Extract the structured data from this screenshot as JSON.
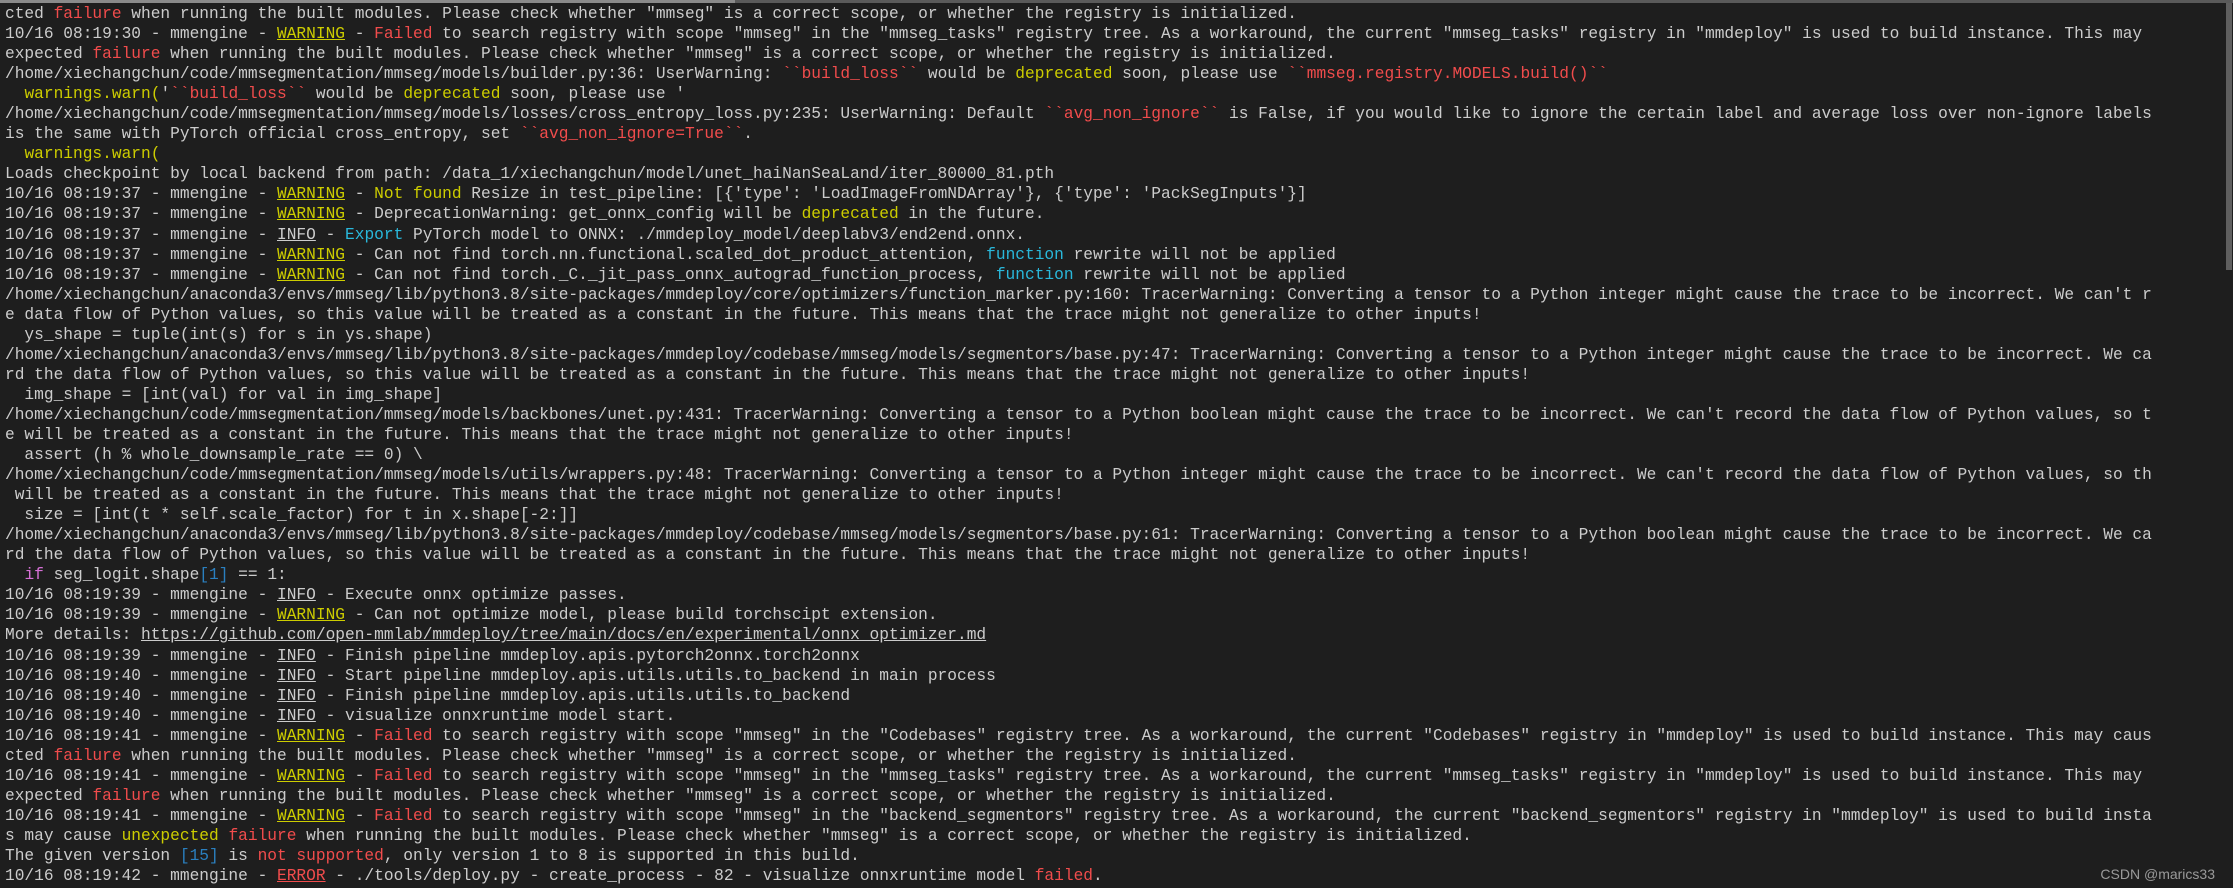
{
  "colors": {
    "background": "#1e1e1e",
    "text": "#cccccc",
    "red": "#f14c4c",
    "yellow": "#cdcd00",
    "cyan": "#29b8db",
    "magenta": "#d670d6",
    "blue": "#2a7fbf"
  },
  "watermark": "CSDN @marics33",
  "lines": [
    [
      [
        "cted ",
        ""
      ],
      [
        "failure",
        "r"
      ],
      [
        " when running the built modules. Please check whether \"mmseg\" is a correct scope, or whether the registry is initialized.",
        ""
      ]
    ],
    [
      [
        "10/16 08:19:30 - mmengine - ",
        ""
      ],
      [
        "WARNING",
        "wu"
      ],
      [
        " - ",
        ""
      ],
      [
        "Failed",
        "r"
      ],
      [
        " to search registry with scope \"mmseg\" in the \"mmseg_tasks\" registry tree. As a workaround, the current \"mmseg_tasks\" registry in \"mmdeploy\" is used to build instance. This may",
        ""
      ]
    ],
    [
      [
        "expected ",
        ""
      ],
      [
        "failure",
        "r"
      ],
      [
        " when running the built modules. Please check whether \"mmseg\" is a correct scope, or whether the registry is initialized.",
        ""
      ]
    ],
    [
      [
        "/home/xiechangchun/code/mmsegmentation/mmseg/models/builder.py:36: UserWarning: ",
        ""
      ],
      [
        "``build_loss``",
        "r"
      ],
      [
        " would be ",
        ""
      ],
      [
        "deprecated",
        "y"
      ],
      [
        " soon, please use ",
        ""
      ],
      [
        "``mmseg.registry.MODELS.build()``",
        "r"
      ]
    ],
    [
      [
        "  ",
        ""
      ],
      [
        "warnings.warn(",
        "y"
      ],
      [
        "'",
        ""
      ],
      [
        "``build_loss``",
        "r"
      ],
      [
        " would be ",
        ""
      ],
      [
        "deprecated",
        "y"
      ],
      [
        " soon, please use '",
        ""
      ]
    ],
    [
      [
        "/home/xiechangchun/code/mmsegmentation/mmseg/models/losses/cross_entropy_loss.py:235: UserWarning: Default ",
        ""
      ],
      [
        "``avg_non_ignore``",
        "r"
      ],
      [
        " is False, if you would like to ignore the certain label and average loss over non-ignore labels",
        ""
      ]
    ],
    [
      [
        "is the same with PyTorch official cross_entropy, set ",
        ""
      ],
      [
        "``avg_non_ignore=True``",
        "r"
      ],
      [
        ".",
        ""
      ]
    ],
    [
      [
        "  ",
        ""
      ],
      [
        "warnings.warn(",
        "y"
      ]
    ],
    [
      [
        "Loads checkpoint by local backend from path: /data_1/xiechangchun/model/unet_haiNanSeaLand/iter_80000_81.pth",
        ""
      ]
    ],
    [
      [
        "10/16 08:19:37 - mmengine - ",
        ""
      ],
      [
        "WARNING",
        "wu"
      ],
      [
        " - ",
        ""
      ],
      [
        "Not found",
        "y"
      ],
      [
        " Resize in test_pipeline: [{'type': 'LoadImageFromNDArray'}, {'type': 'PackSegInputs'}]",
        ""
      ]
    ],
    [
      [
        "10/16 08:19:37 - mmengine - ",
        ""
      ],
      [
        "WARNING",
        "wu"
      ],
      [
        " - DeprecationWarning: get_onnx_config will be ",
        ""
      ],
      [
        "deprecated",
        "y"
      ],
      [
        " in the future.",
        ""
      ]
    ],
    [
      [
        "10/16 08:19:37 - mmengine - ",
        ""
      ],
      [
        "INFO",
        "iu"
      ],
      [
        " - ",
        ""
      ],
      [
        "Export",
        "c"
      ],
      [
        " PyTorch model to ONNX: ./mmdeploy_model/deeplabv3/end2end.onnx.",
        ""
      ]
    ],
    [
      [
        "10/16 08:19:37 - mmengine - ",
        ""
      ],
      [
        "WARNING",
        "wu"
      ],
      [
        " - Can not find torch.nn.functional.scaled_dot_product_attention, ",
        ""
      ],
      [
        "function",
        "c"
      ],
      [
        " rewrite will not be applied",
        ""
      ]
    ],
    [
      [
        "10/16 08:19:37 - mmengine - ",
        ""
      ],
      [
        "WARNING",
        "wu"
      ],
      [
        " - Can not find torch._C._jit_pass_onnx_autograd_function_process, ",
        ""
      ],
      [
        "function",
        "c"
      ],
      [
        " rewrite will not be applied",
        ""
      ]
    ],
    [
      [
        "/home/xiechangchun/anaconda3/envs/mmseg/lib/python3.8/site-packages/mmdeploy/core/optimizers/function_marker.py:160: TracerWarning: Converting a tensor to a Python integer might cause the trace to be incorrect. We can't r",
        ""
      ]
    ],
    [
      [
        "e data flow of Python values, so this value will be treated as a constant in the future. This means that the trace might not generalize to other inputs!",
        ""
      ]
    ],
    [
      [
        "  ys_shape = tuple(int(s) for s in ys.shape)",
        ""
      ]
    ],
    [
      [
        "/home/xiechangchun/anaconda3/envs/mmseg/lib/python3.8/site-packages/mmdeploy/codebase/mmseg/models/segmentors/base.py:47: TracerWarning: Converting a tensor to a Python integer might cause the trace to be incorrect. We ca",
        ""
      ]
    ],
    [
      [
        "rd the data flow of Python values, so this value will be treated as a constant in the future. This means that the trace might not generalize to other inputs!",
        ""
      ]
    ],
    [
      [
        "  img_shape = [int(val) for val in img_shape]",
        ""
      ]
    ],
    [
      [
        "/home/xiechangchun/code/mmsegmentation/mmseg/models/backbones/unet.py:431: TracerWarning: Converting a tensor to a Python boolean might cause the trace to be incorrect. We can't record the data flow of Python values, so t",
        ""
      ]
    ],
    [
      [
        "e will be treated as a constant in the future. This means that the trace might not generalize to other inputs!",
        ""
      ]
    ],
    [
      [
        "  assert (h % whole_downsample_rate == 0) \\",
        ""
      ]
    ],
    [
      [
        "/home/xiechangchun/code/mmsegmentation/mmseg/models/utils/wrappers.py:48: TracerWarning: Converting a tensor to a Python integer might cause the trace to be incorrect. We can't record the data flow of Python values, so th",
        ""
      ]
    ],
    [
      [
        " will be treated as a constant in the future. This means that the trace might not generalize to other inputs!",
        ""
      ]
    ],
    [
      [
        "  size = [int(t * self.scale_factor) for t in x.shape[-2:]]",
        ""
      ]
    ],
    [
      [
        "/home/xiechangchun/anaconda3/envs/mmseg/lib/python3.8/site-packages/mmdeploy/codebase/mmseg/models/segmentors/base.py:61: TracerWarning: Converting a tensor to a Python boolean might cause the trace to be incorrect. We ca",
        ""
      ]
    ],
    [
      [
        "rd the data flow of Python values, so this value will be treated as a constant in the future. This means that the trace might not generalize to other inputs!",
        ""
      ]
    ],
    [
      [
        "  ",
        ""
      ],
      [
        "if",
        "m"
      ],
      [
        " seg_logit.shape",
        ""
      ],
      [
        "[1]",
        "b"
      ],
      [
        " == 1:",
        ""
      ]
    ],
    [
      [
        "10/16 08:19:39 - mmengine - ",
        ""
      ],
      [
        "INFO",
        "iu"
      ],
      [
        " - Execute onnx optimize passes.",
        ""
      ]
    ],
    [
      [
        "10/16 08:19:39 - mmengine - ",
        ""
      ],
      [
        "WARNING",
        "wu"
      ],
      [
        " - Can not optimize model, please build torchscipt extension.",
        ""
      ]
    ],
    [
      [
        "More details: ",
        ""
      ],
      [
        "https://github.com/open-mmlab/mmdeploy/tree/main/docs/en/experimental/onnx_optimizer.md",
        "u"
      ]
    ],
    [
      [
        "10/16 08:19:39 - mmengine - ",
        ""
      ],
      [
        "INFO",
        "iu"
      ],
      [
        " - Finish pipeline mmdeploy.apis.pytorch2onnx.torch2onnx",
        ""
      ]
    ],
    [
      [
        "10/16 08:19:40 - mmengine - ",
        ""
      ],
      [
        "INFO",
        "iu"
      ],
      [
        " - Start pipeline mmdeploy.apis.utils.utils.to_backend in main process",
        ""
      ]
    ],
    [
      [
        "10/16 08:19:40 - mmengine - ",
        ""
      ],
      [
        "INFO",
        "iu"
      ],
      [
        " - Finish pipeline mmdeploy.apis.utils.utils.to_backend",
        ""
      ]
    ],
    [
      [
        "10/16 08:19:40 - mmengine - ",
        ""
      ],
      [
        "INFO",
        "iu"
      ],
      [
        " - visualize onnxruntime model start.",
        ""
      ]
    ],
    [
      [
        "10/16 08:19:41 - mmengine - ",
        ""
      ],
      [
        "WARNING",
        "wu"
      ],
      [
        " - ",
        ""
      ],
      [
        "Failed",
        "r"
      ],
      [
        " to search registry with scope \"mmseg\" in the \"Codebases\" registry tree. As a workaround, the current \"Codebases\" registry in \"mmdeploy\" is used to build instance. This may caus",
        ""
      ]
    ],
    [
      [
        "cted ",
        ""
      ],
      [
        "failure",
        "r"
      ],
      [
        " when running the built modules. Please check whether \"mmseg\" is a correct scope, or whether the registry is initialized.",
        ""
      ]
    ],
    [
      [
        "10/16 08:19:41 - mmengine - ",
        ""
      ],
      [
        "WARNING",
        "wu"
      ],
      [
        " - ",
        ""
      ],
      [
        "Failed",
        "r"
      ],
      [
        " to search registry with scope \"mmseg\" in the \"mmseg_tasks\" registry tree. As a workaround, the current \"mmseg_tasks\" registry in \"mmdeploy\" is used to build instance. This may",
        ""
      ]
    ],
    [
      [
        "expected ",
        ""
      ],
      [
        "failure",
        "r"
      ],
      [
        " when running the built modules. Please check whether \"mmseg\" is a correct scope, or whether the registry is initialized.",
        ""
      ]
    ],
    [
      [
        "10/16 08:19:41 - mmengine - ",
        ""
      ],
      [
        "WARNING",
        "wu"
      ],
      [
        " - ",
        ""
      ],
      [
        "Failed",
        "r"
      ],
      [
        " to search registry with scope \"mmseg\" in the \"backend_segmentors\" registry tree. As a workaround, the current \"backend_segmentors\" registry in \"mmdeploy\" is used to build insta",
        ""
      ]
    ],
    [
      [
        "s may cause ",
        ""
      ],
      [
        "unexpected",
        "y"
      ],
      [
        " ",
        ""
      ],
      [
        "failure",
        "r"
      ],
      [
        " when running the built modules. Please check whether \"mmseg\" is a correct scope, or whether the registry is initialized.",
        ""
      ]
    ],
    [
      [
        "The given version ",
        ""
      ],
      [
        "[15]",
        "b"
      ],
      [
        " is ",
        ""
      ],
      [
        "not supported",
        "r"
      ],
      [
        ", only version 1 to 8 is supported in this build.",
        ""
      ]
    ],
    [
      [
        "10/16 08:19:42 - mmengine - ",
        ""
      ],
      [
        "ERROR",
        "eu"
      ],
      [
        " - ./tools/deploy.py - create_process - 82 - visualize onnxruntime model ",
        ""
      ],
      [
        "failed",
        "r"
      ],
      [
        ".",
        ""
      ]
    ]
  ]
}
